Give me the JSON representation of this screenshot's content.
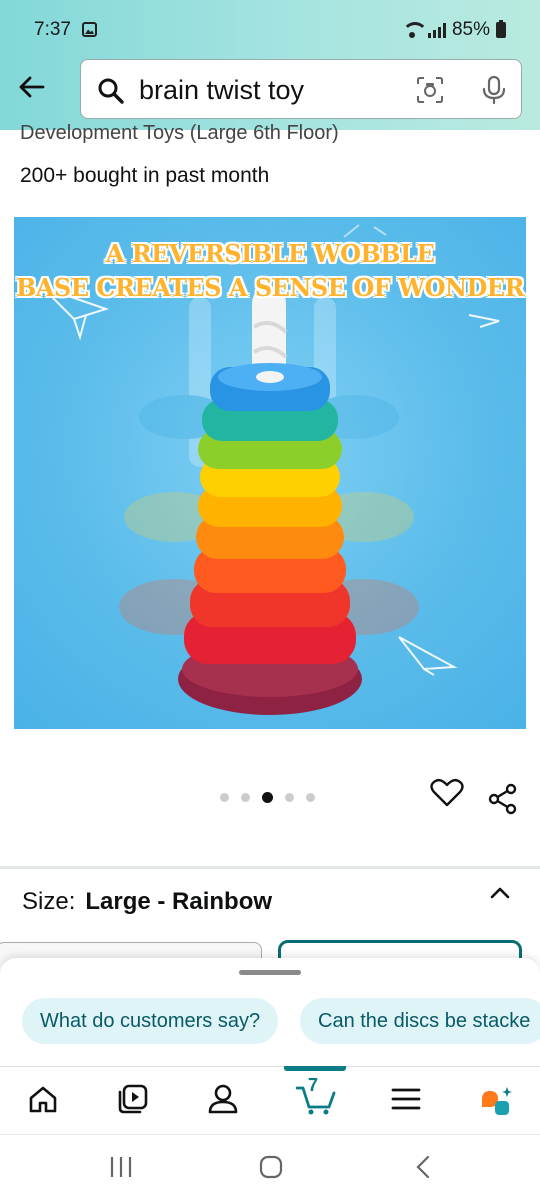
{
  "status_bar": {
    "time": "7:37",
    "battery": "85%"
  },
  "search": {
    "query": "brain twist toy"
  },
  "product": {
    "title_fragment": "Development Toys (Large 6th Floor)",
    "bought": "200+ bought in past month",
    "image_banner_line1": "A REVERSIBLE WOBBLE",
    "image_banner_line2": "BASE CREATES A SENSE OF WONDER",
    "image_pager": {
      "total": 5,
      "active_index": 2
    }
  },
  "size": {
    "label": "Size:",
    "value": "Large - Rainbow"
  },
  "suggestions": [
    {
      "label": "What do customers say?"
    },
    {
      "label": "Can the discs be stacke"
    }
  ],
  "tabbar": {
    "items": [
      "home-icon",
      "video-play-icon",
      "account-icon",
      "cart-icon",
      "menu-icon",
      "rufus-icon"
    ],
    "active": "cart-icon",
    "cart_count": "7"
  },
  "colors": {
    "accent": "#0a7c86",
    "chip_bg": "#dff4f7",
    "header_gradient_start": "#82d8d8"
  }
}
